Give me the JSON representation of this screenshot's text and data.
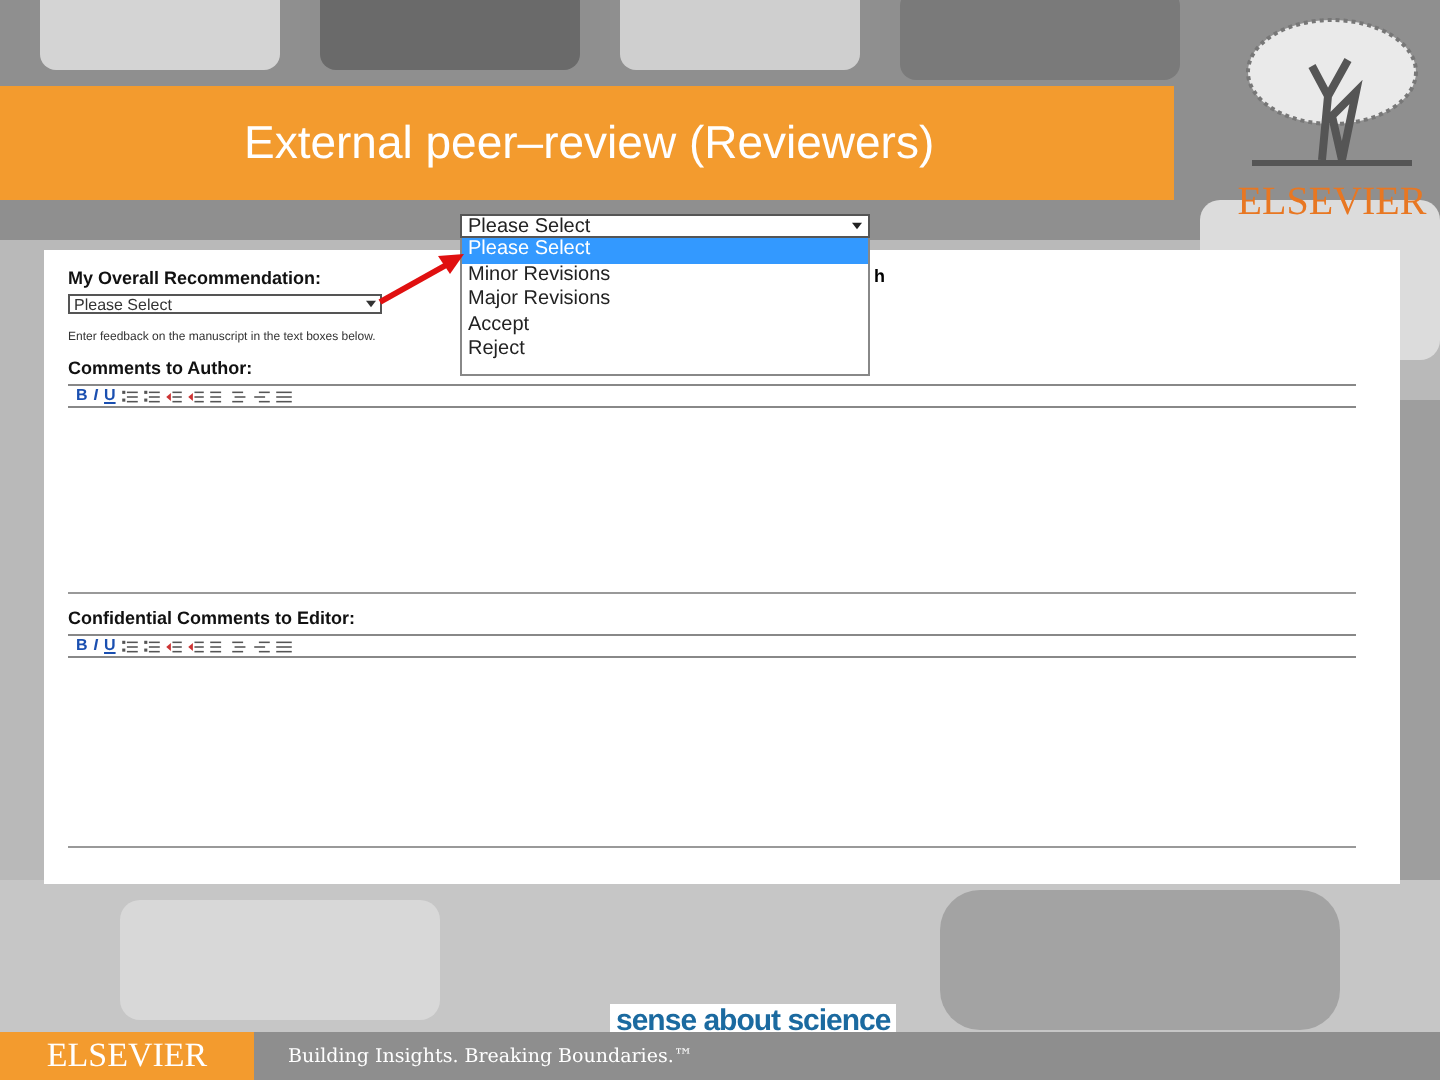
{
  "slide": {
    "title": "External peer–review (Reviewers)",
    "logo_text": "ELSEVIER"
  },
  "form": {
    "recommendation": {
      "label": "My Overall Recommendation:",
      "select_value": "Please Select"
    },
    "cut_text": "h",
    "instruction": "Enter feedback on the manuscript in the text boxes below.",
    "sections": [
      {
        "label": "Comments to Author:",
        "toolbar": [
          "B",
          "I",
          "U"
        ]
      },
      {
        "label": "Confidential Comments to Editor:",
        "toolbar": [
          "B",
          "I",
          "U"
        ]
      }
    ]
  },
  "dropdown": {
    "value": "Please Select",
    "options": [
      {
        "label": "Please Select",
        "selected": true
      },
      {
        "label": "Minor Revisions",
        "selected": false
      },
      {
        "label": "Major Revisions",
        "selected": false
      },
      {
        "label": "Accept",
        "selected": false
      },
      {
        "label": "Reject",
        "selected": false
      }
    ]
  },
  "footer": {
    "brand": "ELSEVIER",
    "tagline": "Building Insights. Breaking Boundaries.™",
    "badge": "sense about science"
  }
}
